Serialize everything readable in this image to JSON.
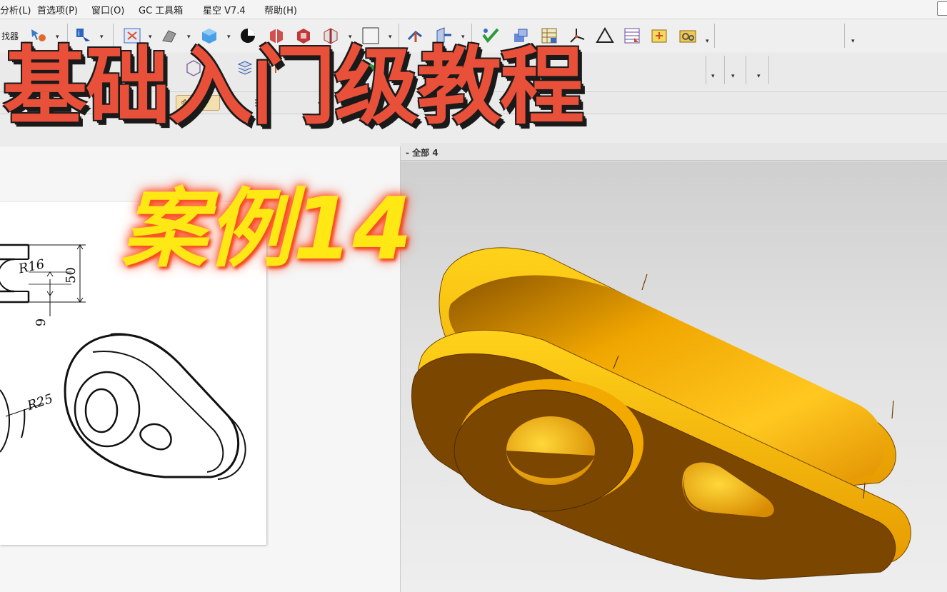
{
  "menubar": {
    "items": [
      "分析(L)",
      "首选项(P)",
      "窗口(O)",
      "GC 工具箱",
      "星空 V7.4",
      "帮助(H)"
    ]
  },
  "toolbar": {
    "finder_label": "找器",
    "dropdown_glyph": "▾"
  },
  "nav": {
    "tab_label": "会员"
  },
  "viewport": {
    "label": "- 全部 4"
  },
  "drawing": {
    "dim_r16": "R16",
    "dim_50": "50",
    "dim_9": "9",
    "dim_r25": "R25"
  },
  "overlay": {
    "title": "基础入门级教程",
    "case_label": "案例14"
  },
  "colors": {
    "part_orange": "#f2a900",
    "part_dark": "#7a4a00",
    "title_red": "#e8503a",
    "case_yellow": "#ffe814"
  }
}
